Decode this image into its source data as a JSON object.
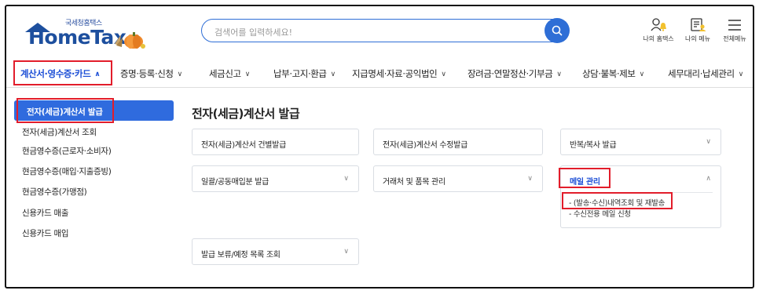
{
  "header": {
    "logo_small": "국세청홈택스",
    "logo_main": "HomeTax",
    "search_placeholder": "검색어를 입력하세요!",
    "icons": [
      {
        "label": "나의 홈택스",
        "icon": "user-bell-icon"
      },
      {
        "label": "나의 메뉴",
        "icon": "menu-list-icon"
      },
      {
        "label": "전체메뉴",
        "icon": "hamburger-icon"
      }
    ]
  },
  "nav": {
    "items": [
      {
        "label": "계산서·영수증·카드",
        "active": true
      },
      {
        "label": "증명·등록·신청",
        "active": false
      },
      {
        "label": "세금신고",
        "active": false
      },
      {
        "label": "납부·고지·환급",
        "active": false
      },
      {
        "label": "지급명세·자료·공익법인",
        "active": false
      },
      {
        "label": "장려금·연말정산·기부금",
        "active": false
      },
      {
        "label": "상담·불복·제보",
        "active": false
      },
      {
        "label": "세무대리·납세관리",
        "active": false
      }
    ]
  },
  "sidebar": {
    "items": [
      {
        "label": "전자(세금)계산서 발급",
        "active": true
      },
      {
        "label": "전자(세금)계산서 조회",
        "active": false
      },
      {
        "label": "현금영수증(근로자·소비자)",
        "active": false
      },
      {
        "label": "현금영수증(매입·지출증빙)",
        "active": false
      },
      {
        "label": "현금영수증(가맹점)",
        "active": false
      },
      {
        "label": "신용카드 매출",
        "active": false
      },
      {
        "label": "신용카드 매입",
        "active": false
      }
    ]
  },
  "main": {
    "title": "전자(세금)계산서 발급",
    "cards": [
      {
        "label": "전자(세금)계산서 건별발급",
        "chevron": false
      },
      {
        "label": "전자(세금)계산서 수정발급",
        "chevron": false
      },
      {
        "label": "반복/복사 발급",
        "chevron": true
      },
      {
        "label": "일괄/공동매입분 발급",
        "chevron": true
      },
      {
        "label": "거래처 및 품목 관리",
        "chevron": true
      },
      {
        "label": "메일 관리",
        "chevron": true,
        "open": true
      },
      {
        "label": "발급 보류/예정 목록 조회",
        "chevron": true
      }
    ],
    "mail_submenu": [
      "(발송·수신)내역조회 및 재발송",
      "수신전용 메일 신청"
    ]
  },
  "colors": {
    "brand_blue": "#1d4f9e",
    "accent_blue": "#2f6bde",
    "highlight_red": "#e21d2b"
  }
}
